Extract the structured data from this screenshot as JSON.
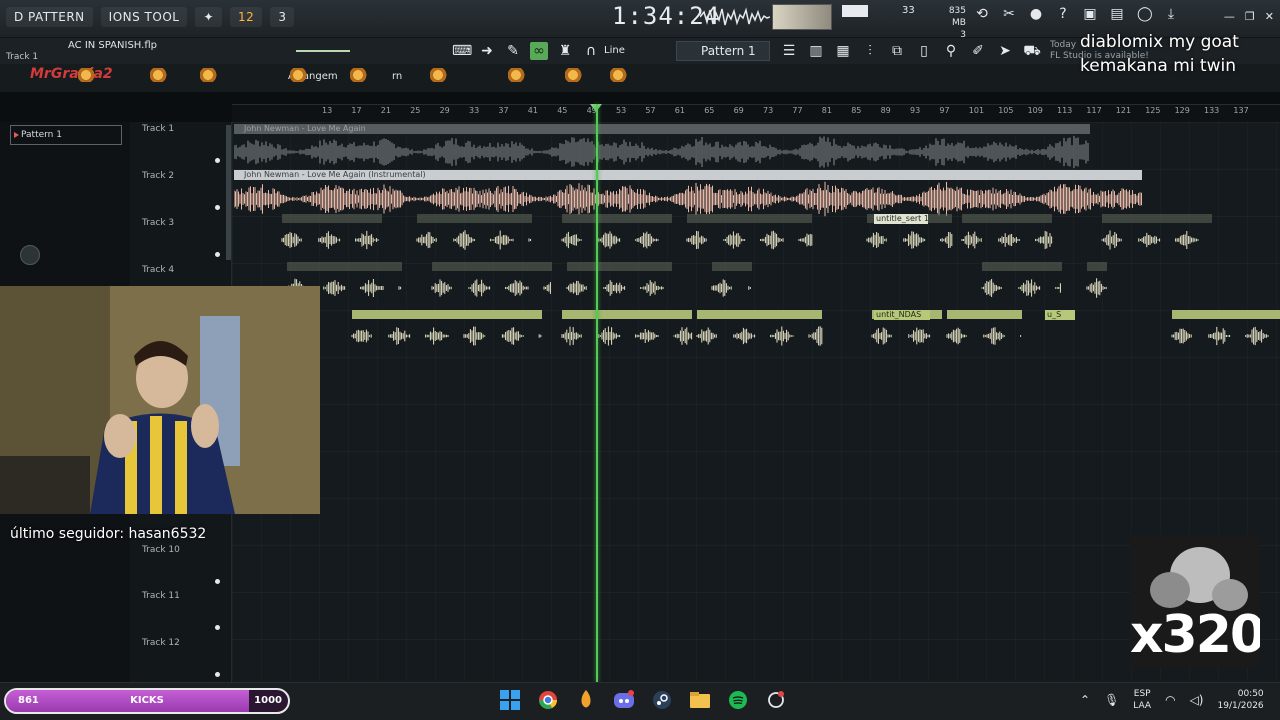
{
  "menu": {
    "items": [
      "D PATTERN",
      "IONS TOOL",
      "",
      "12",
      "3"
    ],
    "hot_index": 3
  },
  "transport": {
    "time": "1:34:24"
  },
  "monitor": {
    "cpu": "33",
    "memory": "835 MB",
    "memory_sub": "3"
  },
  "file": {
    "name": "AC IN SPANISH.flp",
    "track_hint": "Track 1"
  },
  "toolbar": {
    "snap_label": "Line",
    "pattern_label": "Pattern 1",
    "news_line1": "Today",
    "news_line2": "FL Studio is available!"
  },
  "row3": {
    "nick": "MrGrania2",
    "arrangement": "Arrangem",
    "arr_tail": "rn"
  },
  "ruler": {
    "bars": [
      "13",
      "17",
      "21",
      "25",
      "29",
      "33",
      "37",
      "41",
      "45",
      "49",
      "53",
      "57",
      "61",
      "65",
      "69",
      "73",
      "77",
      "81",
      "85",
      "89",
      "93",
      "97",
      "101",
      "105",
      "109",
      "113",
      "117",
      "121",
      "125",
      "129",
      "133",
      "137"
    ]
  },
  "pattern_panel": {
    "selected": "Pattern 1"
  },
  "tracks": [
    {
      "name": "Track 1"
    },
    {
      "name": "Track 2"
    },
    {
      "name": "Track 3"
    },
    {
      "name": "Track 4"
    },
    {
      "name": "Track 10"
    },
    {
      "name": "Track 11"
    },
    {
      "name": "Track 12"
    }
  ],
  "clips": {
    "track1_title": "John Newman - Love Me Again",
    "track2_title": "John Newman - Love Me Again (Instrumental)",
    "track3_label": "untitle_sert 1",
    "track5_label1": "untit_NDAS",
    "track5_label2": "u_S",
    "colors": {
      "track1": "#8a8f92",
      "track2": "#e8b9a8",
      "vocal": "#e8e4c6",
      "vocal_header": "#b7c87a"
    }
  },
  "stream": {
    "line1": "diablomix my goat",
    "line2": "kemakana mi twin",
    "follower": "último seguidor: hasan6532",
    "overlay": "x320"
  },
  "goal": {
    "start": "861",
    "label": "KICKS",
    "end": "1000",
    "progress": 0.861
  },
  "tray": {
    "lang1": "ESP",
    "lang2": "LAA",
    "time": "00:50",
    "date": "19/1/2026"
  }
}
